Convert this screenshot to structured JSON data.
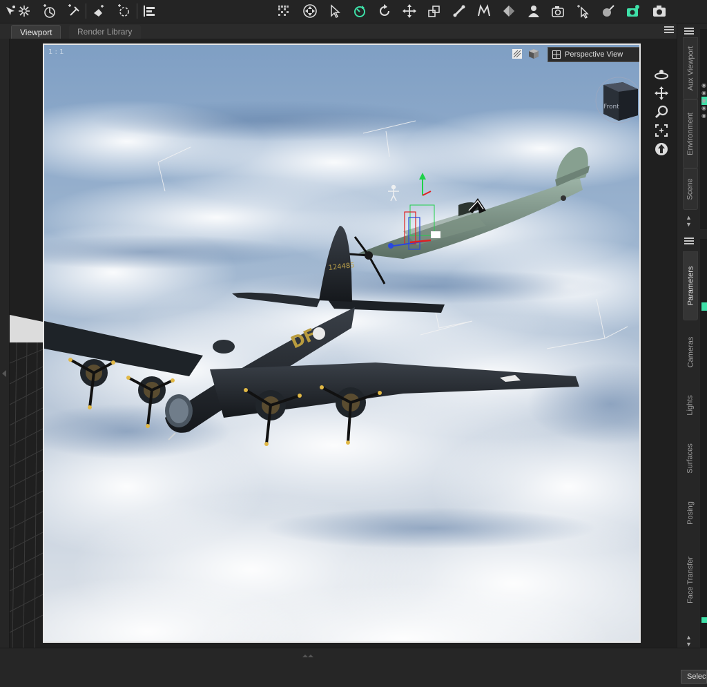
{
  "tabs": [
    {
      "label": "Viewport",
      "active": true
    },
    {
      "label": "Render Library",
      "active": false
    }
  ],
  "toolbar": {
    "tools": [
      "node-selection-icon",
      "joint-editor-icon",
      "rigid-follow-icon",
      "geometry-editor-icon",
      "spot-render-icon",
      "region-nav-icon",
      "scene-align-icon",
      "grid-icon",
      "universal-tool-icon",
      "pointer-icon",
      "rotate-tool-icon",
      "twist-tool-icon",
      "translate-tool-icon",
      "scale-tool-icon",
      "joint-editor-bone-icon",
      "morph-tool-icon",
      "pose-tool-icon",
      "figure-tool-icon",
      "render-settings-icon",
      "surface-selection-icon",
      "shader-tool-icon",
      "iray-render-icon",
      "render-camera-icon"
    ]
  },
  "viewport": {
    "label": "1 : 1",
    "view_mode": "Perspective View",
    "nav_tools": [
      "orbit-icon",
      "pan-icon",
      "zoom-icon",
      "frame-icon",
      "home-icon"
    ],
    "viewcube_face": "Front"
  },
  "right_panel": {
    "top_tabs": [
      "Aux Viewport",
      "Environment",
      "Scene"
    ],
    "bottom_tabs": [
      "Parameters",
      "Cameras",
      "Lights",
      "Surfaces",
      "Posing",
      "Face Transfer"
    ],
    "active_tab": "Parameters"
  },
  "bottom": {
    "select_label": "Select"
  },
  "colors": {
    "accent": "#3ee0a8",
    "panel": "#262626",
    "viewport_border": "#e8e8e8"
  }
}
